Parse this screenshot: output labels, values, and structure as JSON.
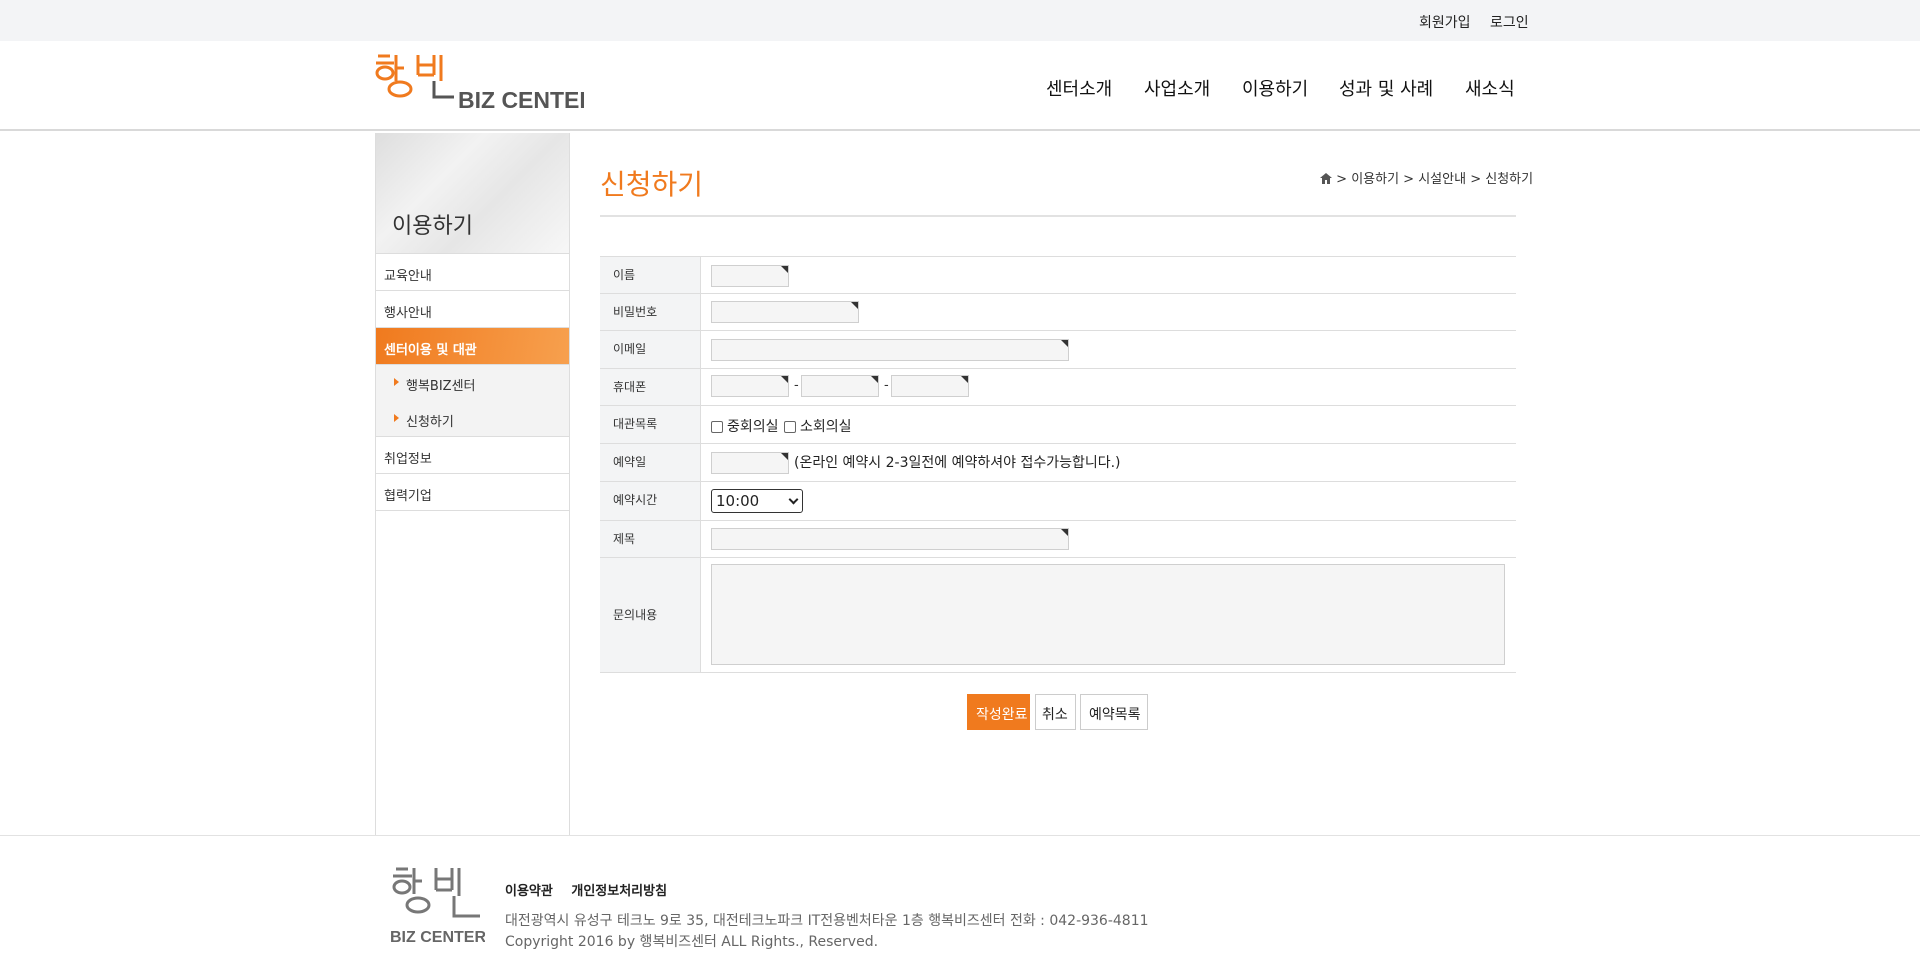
{
  "topbar": {
    "signup": "회원가입",
    "login": "로그인"
  },
  "logo": {
    "text": "BIZ CENTER",
    "accent": "#f07a1e"
  },
  "gnb": [
    "센터소개",
    "사업소개",
    "이용하기",
    "성과 및 사례",
    "새소식"
  ],
  "sidebar": {
    "title": "이용하기",
    "items": [
      {
        "label": "교육안내"
      },
      {
        "label": "행사안내"
      },
      {
        "label": "센터이용 및 대관",
        "active": true
      },
      {
        "label": "행복BIZ센터",
        "sub": true
      },
      {
        "label": "신청하기",
        "sub": true
      },
      {
        "label": "취업정보"
      },
      {
        "label": "협력기업"
      }
    ]
  },
  "page": {
    "title": "신청하기"
  },
  "breadcrumb": {
    "home_icon": "home-icon",
    "items": [
      "이용하기",
      "시설안내",
      "신청하기"
    ]
  },
  "form": {
    "name_label": "이름",
    "password_label": "비밀번호",
    "email_label": "이메일",
    "phone_label": "휴대폰",
    "phone_sep": "-",
    "rooms_label": "대관목록",
    "room1": "중회의실",
    "room2": "소회의실",
    "date_label": "예약일",
    "date_note": "(온라인 예약시 2-3일전에 예약하셔야 접수가능합니다.)",
    "time_label": "예약시간",
    "time_value": "10:00",
    "subject_label": "제목",
    "content_label": "문의내용"
  },
  "buttons": {
    "submit": "작성완료",
    "cancel": "취소",
    "list": "예약목록"
  },
  "footer": {
    "terms": "이용약관",
    "privacy": "개인정보처리방침",
    "address": "대전광역시 유성구 테크노 9로 35, 대전테크노파크 IT전용벤처타운 1층 행복비즈센터 전화 : 042-936-4811",
    "copyright": "Copyright 2016 by 행복비즈센터 ALL Rights., Reserved.",
    "logo_text": "BIZ CENTER"
  }
}
